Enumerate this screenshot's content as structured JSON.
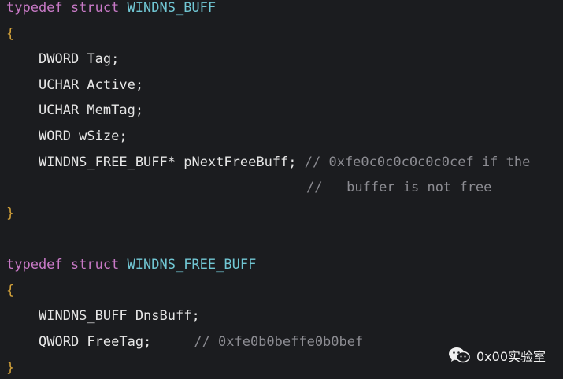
{
  "code": {
    "struct1": {
      "keyword": "typedef struct",
      "name": "WINDNS_BUFF",
      "open_brace": "{",
      "fields": [
        "DWORD Tag;",
        "UCHAR Active;",
        "UCHAR MemTag;",
        "WORD wSize;"
      ],
      "pointer_field": "WINDNS_FREE_BUFF* pNextFreeBuff;",
      "pointer_comment_1": "// 0xfe0c0c0c0c0c0cef if the",
      "pointer_comment_2": "//   buffer is not free",
      "close_brace": "}"
    },
    "struct2": {
      "keyword": "typedef struct",
      "name": "WINDNS_FREE_BUFF",
      "open_brace": "{",
      "field1": "WINDNS_BUFF DnsBuff;",
      "field2": "QWORD FreeTag;",
      "field2_comment": "// 0xfe0b0beffe0b0bef",
      "close_brace": "}"
    }
  },
  "watermark": {
    "label": "0x00实验室",
    "icon": "wechat-icon"
  },
  "colors": {
    "background": "#1b1c1f",
    "keyword": "#c879c6",
    "type": "#71c7d4",
    "brace": "#d5a33a",
    "text": "#e6e6e6",
    "comment": "#8c8c92"
  }
}
